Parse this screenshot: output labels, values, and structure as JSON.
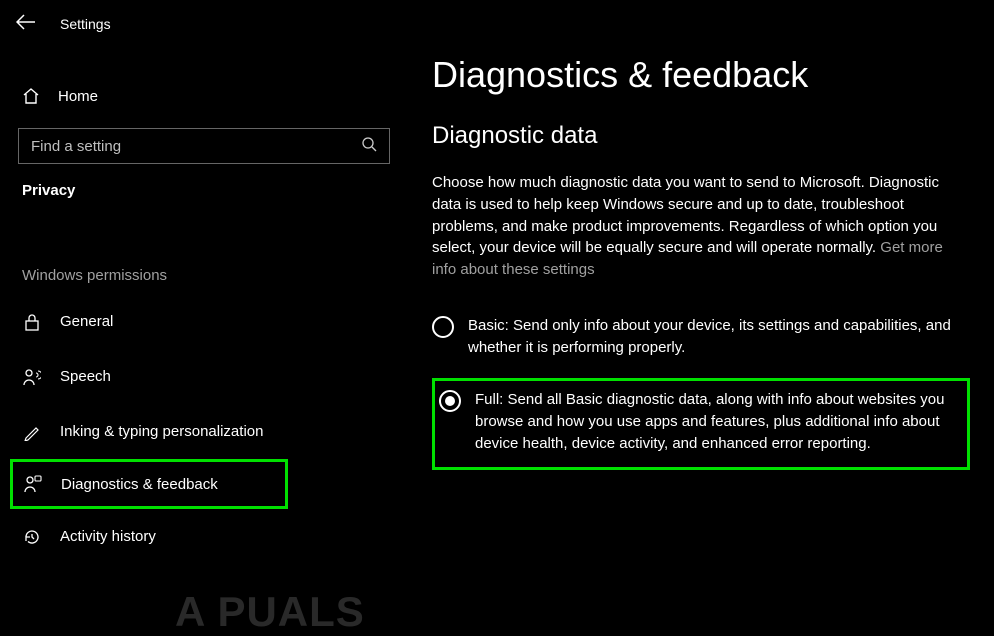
{
  "header": {
    "app_title": "Settings"
  },
  "sidebar": {
    "home_label": "Home",
    "search_placeholder": "Find a setting",
    "category": "Privacy",
    "group": "Windows permissions",
    "items": [
      {
        "label": "General"
      },
      {
        "label": "Speech"
      },
      {
        "label": "Inking & typing personalization"
      },
      {
        "label": "Diagnostics & feedback"
      },
      {
        "label": "Activity history"
      }
    ]
  },
  "main": {
    "title": "Diagnostics & feedback",
    "section": "Diagnostic data",
    "description": "Choose how much diagnostic data you want to send to Microsoft. Diagnostic data is used to help keep Windows secure and up to date, troubleshoot problems, and make product improvements. Regardless of which option you select, your device will be equally secure and will operate normally.",
    "more_info": "Get more info about these settings",
    "options": {
      "basic": "Basic: Send only info about your device, its settings and capabilities, and whether it is performing properly.",
      "full": "Full: Send all Basic diagnostic data, along with info about websites you browse and how you use apps and features, plus additional info about device health, device activity, and enhanced error reporting."
    }
  },
  "watermark": "A   PUALS"
}
